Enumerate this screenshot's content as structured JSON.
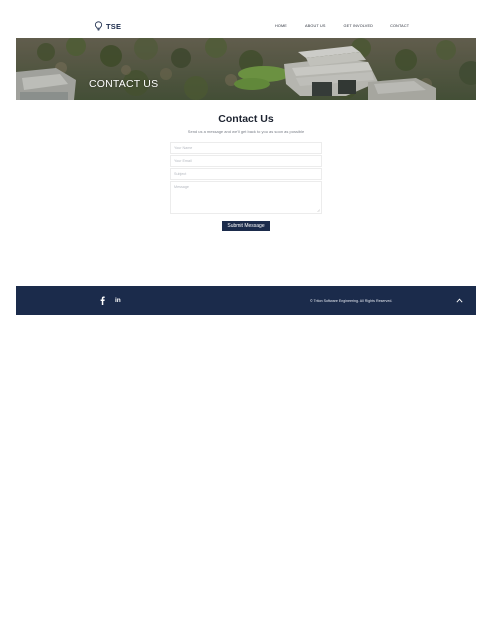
{
  "brand": {
    "name": "TSE",
    "logo_icon": "lightbulb-icon"
  },
  "nav": {
    "items": [
      {
        "label": "HOME"
      },
      {
        "label": "ABOUT US"
      },
      {
        "label": "GET INVOLVED"
      },
      {
        "label": "CONTACT"
      }
    ]
  },
  "hero": {
    "title": "CONTACT US",
    "image": "aerial campus photo"
  },
  "contact": {
    "heading": "Contact Us",
    "subheading": "Send us a message and we'll get back to you as soon as possible",
    "fields": {
      "name": {
        "placeholder": "Your Name",
        "value": ""
      },
      "email": {
        "placeholder": "Your Email",
        "value": ""
      },
      "subject": {
        "placeholder": "Subject",
        "value": ""
      },
      "message": {
        "placeholder": "Message",
        "value": ""
      }
    },
    "submit_label": "Submit Message"
  },
  "footer": {
    "social": [
      {
        "icon": "facebook-icon",
        "glyph": "f"
      },
      {
        "icon": "linkedin-icon",
        "glyph": "in"
      }
    ],
    "copyright": "© Triton Software Engineering. All Rights Reserved.",
    "back_to_top_icon": "chevron-up-icon"
  },
  "colors": {
    "navy": "#1b2b4b",
    "text": "#1d2330",
    "muted": "#7a7f88"
  }
}
